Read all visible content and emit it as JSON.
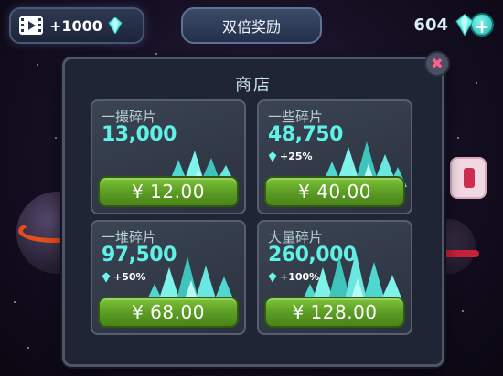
{
  "topbar": {
    "video_reward_label": "+1000",
    "double_reward_label": "双倍奖励",
    "gem_balance": "604"
  },
  "shop": {
    "title": "商店",
    "offers": [
      {
        "name": "一撮碎片",
        "amount": "13,000",
        "bonus": "",
        "price": "¥ 12.00"
      },
      {
        "name": "一些碎片",
        "amount": "48,750",
        "bonus": "+25%",
        "price": "¥ 40.00"
      },
      {
        "name": "一堆碎片",
        "amount": "97,500",
        "bonus": "+50%",
        "price": "¥ 68.00"
      },
      {
        "name": "大量碎片",
        "amount": "260,000",
        "bonus": "+100%",
        "price": "¥ 128.00"
      }
    ]
  },
  "colors": {
    "accent_cyan": "#5ff0e6",
    "button_green": "#6cb02e",
    "panel_bg": "#1f2535",
    "close_pink": "#ff5f8f"
  },
  "icons": [
    "video-icon",
    "gem-icon",
    "plus-icon",
    "close-icon",
    "crystal-pile-icon"
  ]
}
